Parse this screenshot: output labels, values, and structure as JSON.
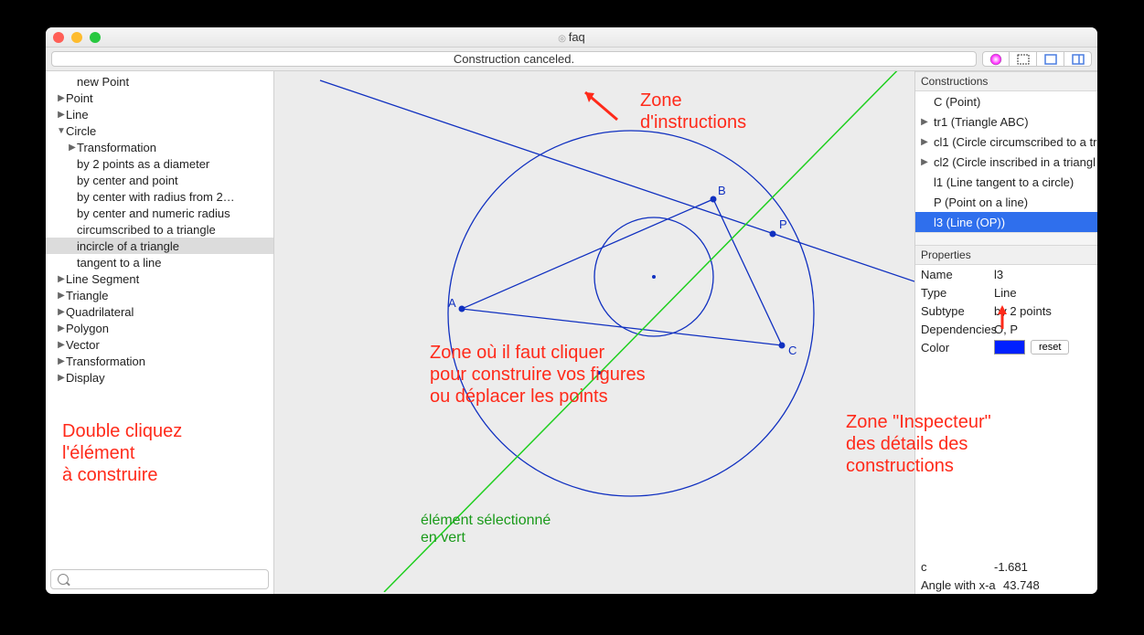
{
  "window": {
    "title": "faq"
  },
  "message_bar": "Construction canceled.",
  "left_tree": {
    "items": [
      {
        "label": "new Point",
        "indent": 1,
        "disclose": ""
      },
      {
        "label": "Point",
        "indent": 0,
        "disclose": "▶"
      },
      {
        "label": "Line",
        "indent": 0,
        "disclose": "▶"
      },
      {
        "label": "Circle",
        "indent": 0,
        "disclose": "▼"
      },
      {
        "label": "Transformation",
        "indent": 1,
        "disclose": "▶"
      },
      {
        "label": "by 2 points as a diameter",
        "indent": 1,
        "disclose": ""
      },
      {
        "label": "by center and point",
        "indent": 1,
        "disclose": ""
      },
      {
        "label": "by center with radius from 2…",
        "indent": 1,
        "disclose": ""
      },
      {
        "label": "by center and numeric radius",
        "indent": 1,
        "disclose": ""
      },
      {
        "label": "circumscribed to a triangle",
        "indent": 1,
        "disclose": ""
      },
      {
        "label": "incircle of a triangle",
        "indent": 1,
        "disclose": "",
        "selected": true
      },
      {
        "label": "tangent to a line",
        "indent": 1,
        "disclose": ""
      },
      {
        "label": "Line Segment",
        "indent": 0,
        "disclose": "▶"
      },
      {
        "label": "Triangle",
        "indent": 0,
        "disclose": "▶"
      },
      {
        "label": "Quadrilateral",
        "indent": 0,
        "disclose": "▶"
      },
      {
        "label": "Polygon",
        "indent": 0,
        "disclose": "▶"
      },
      {
        "label": "Vector",
        "indent": 0,
        "disclose": "▶"
      },
      {
        "label": "Transformation",
        "indent": 0,
        "disclose": "▶"
      },
      {
        "label": "Display",
        "indent": 0,
        "disclose": "▶"
      }
    ]
  },
  "right": {
    "constructions_header": "Constructions",
    "constructions": [
      {
        "label": "C (Point)",
        "disclose": ""
      },
      {
        "label": "tr1 (Triangle ABC)",
        "disclose": "▶"
      },
      {
        "label": "cl1 (Circle circumscribed to a tr",
        "disclose": "▶"
      },
      {
        "label": "cl2 (Circle inscribed in a triangl",
        "disclose": "▶"
      },
      {
        "label": "l1 (Line tangent to a circle)",
        "disclose": ""
      },
      {
        "label": "P (Point on a line)",
        "disclose": ""
      },
      {
        "label": "l3 (Line (OP))",
        "disclose": "",
        "selected": true
      }
    ],
    "properties_header": "Properties",
    "props": {
      "name_label": "Name",
      "name_value": "l3",
      "type_label": "Type",
      "type_value": "Line",
      "subtype_label": "Subtype",
      "subtype_value": "by 2 points",
      "deps_label": "Dependencies",
      "deps_value": "O, P",
      "color_label": "Color",
      "reset_label": "reset",
      "c_label": "c",
      "c_value": "-1.681",
      "angle_label": "Angle with x-a",
      "angle_value": "43.748"
    }
  },
  "canvas": {
    "points": {
      "A": "A",
      "B": "B",
      "C": "C",
      "P": "P"
    }
  },
  "annotations": {
    "instructions": "Zone\nd'instructions",
    "canvas_help": "Zone où il faut cliquer\npour construire vos figures\nou déplacer les points",
    "left_help": "Double cliquez\nl'élément\nà construire",
    "inspector": "Zone \"Inspecteur\"\ndes détails des\nconstructions",
    "selected_green": "élément sélectionné\nen vert"
  }
}
